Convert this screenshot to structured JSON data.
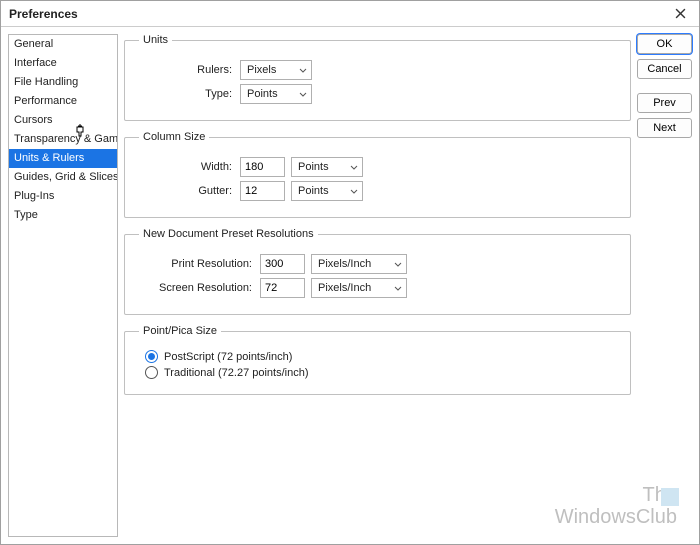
{
  "title": "Preferences",
  "sidebar": {
    "items": [
      {
        "label": "General"
      },
      {
        "label": "Interface"
      },
      {
        "label": "File Handling"
      },
      {
        "label": "Performance"
      },
      {
        "label": "Cursors"
      },
      {
        "label": "Transparency & Gamut"
      },
      {
        "label": "Units & Rulers"
      },
      {
        "label": "Guides, Grid & Slices"
      },
      {
        "label": "Plug-Ins"
      },
      {
        "label": "Type"
      }
    ],
    "selected": 6
  },
  "buttons": {
    "ok": "OK",
    "cancel": "Cancel",
    "prev": "Prev",
    "next": "Next"
  },
  "units_group": {
    "legend": "Units",
    "rulers_label": "Rulers:",
    "rulers_value": "Pixels",
    "type_label": "Type:",
    "type_value": "Points"
  },
  "column_group": {
    "legend": "Column Size",
    "width_label": "Width:",
    "width_value": "180",
    "width_unit": "Points",
    "gutter_label": "Gutter:",
    "gutter_value": "12",
    "gutter_unit": "Points"
  },
  "preset_group": {
    "legend": "New Document Preset Resolutions",
    "print_label": "Print Resolution:",
    "print_value": "300",
    "print_unit": "Pixels/Inch",
    "screen_label": "Screen Resolution:",
    "screen_value": "72",
    "screen_unit": "Pixels/Inch"
  },
  "pointpica_group": {
    "legend": "Point/Pica Size",
    "postscript_label": "PostScript (72 points/inch)",
    "traditional_label": "Traditional (72.27 points/inch)",
    "selected": "postscript"
  },
  "watermark": {
    "line1": "The",
    "line2": "WindowsClub"
  }
}
